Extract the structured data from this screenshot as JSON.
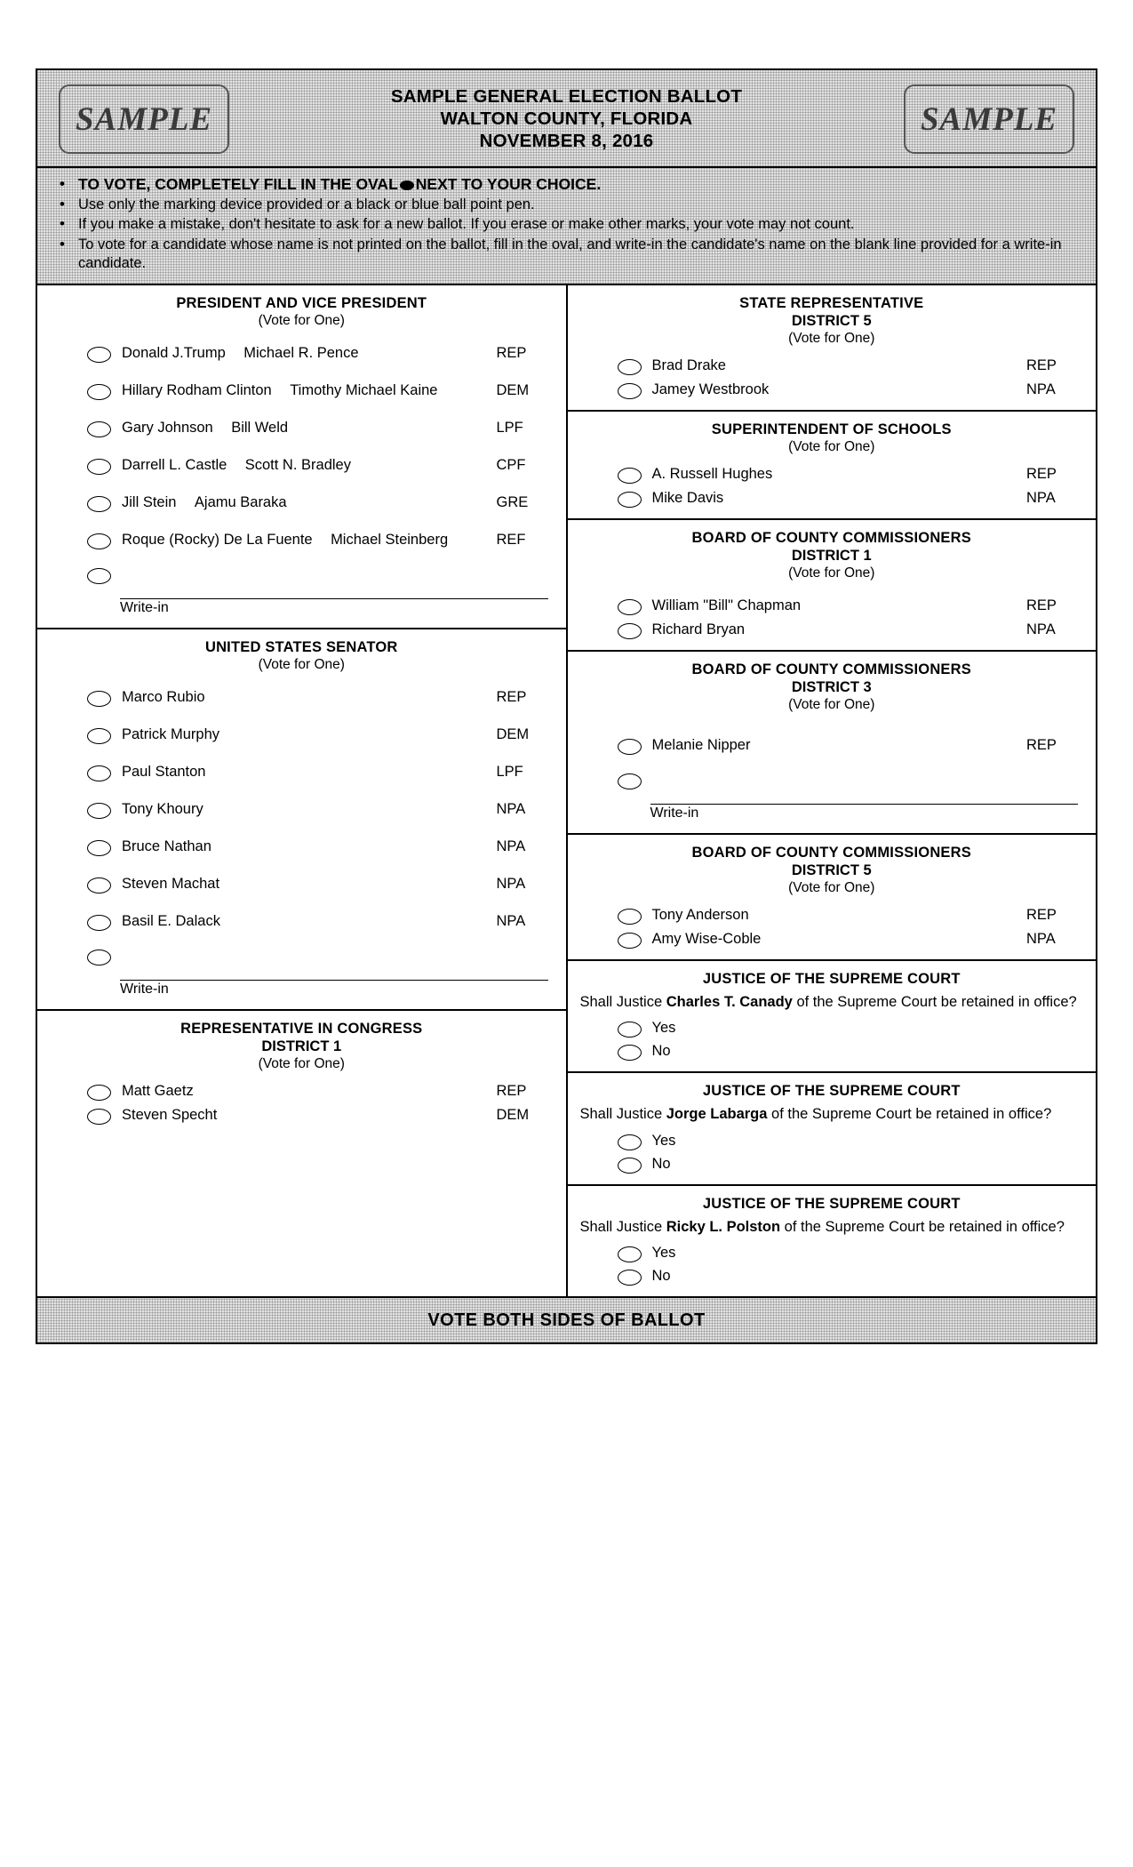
{
  "header": {
    "stamp_left": "SAMPLE",
    "stamp_right": "SAMPLE",
    "line1": "SAMPLE GENERAL ELECTION BALLOT",
    "line2": "WALTON COUNTY, FLORIDA",
    "line3": "NOVEMBER 8, 2016"
  },
  "instructions": {
    "item1_before": "TO VOTE, COMPLETELY FILL IN THE OVAL",
    "item1_after": "NEXT TO YOUR CHOICE.",
    "item2": "Use only the marking device provided or a black or blue ball point pen.",
    "item3": "If you make a mistake, don't hesitate to ask for a new ballot. If you erase or make other marks, your vote may not count.",
    "item4": "To vote for a candidate whose name is not printed on the ballot, fill in the oval, and write-in the candidate's name on the blank line provided for a write-in candidate."
  },
  "left_column": {
    "president": {
      "title": "PRESIDENT AND VICE PRESIDENT",
      "vote_for": "(Vote for One)",
      "candidates": [
        {
          "name": "Donald J.Trump",
          "running_mate": "Michael R. Pence",
          "party": "REP"
        },
        {
          "name": "Hillary Rodham Clinton",
          "running_mate": "Timothy Michael Kaine",
          "party": "DEM"
        },
        {
          "name": "Gary Johnson",
          "running_mate": "Bill Weld",
          "party": "LPF"
        },
        {
          "name": "Darrell L. Castle",
          "running_mate": "Scott N. Bradley",
          "party": "CPF"
        },
        {
          "name": "Jill Stein",
          "running_mate": "Ajamu Baraka",
          "party": "GRE"
        },
        {
          "name": "Roque (Rocky) De La Fuente",
          "running_mate": "Michael Steinberg",
          "party": "REF"
        }
      ],
      "writein_label": "Write-in"
    },
    "senator": {
      "title": "UNITED STATES SENATOR",
      "vote_for": "(Vote for One)",
      "candidates": [
        {
          "name": "Marco Rubio",
          "party": "REP"
        },
        {
          "name": "Patrick Murphy",
          "party": "DEM"
        },
        {
          "name": "Paul Stanton",
          "party": "LPF"
        },
        {
          "name": "Tony Khoury",
          "party": "NPA"
        },
        {
          "name": "Bruce Nathan",
          "party": "NPA"
        },
        {
          "name": "Steven Machat",
          "party": "NPA"
        },
        {
          "name": "Basil E. Dalack",
          "party": "NPA"
        }
      ],
      "writein_label": "Write-in"
    },
    "congress": {
      "title": "REPRESENTATIVE IN CONGRESS",
      "district": "DISTRICT 1",
      "vote_for": "(Vote for One)",
      "candidates": [
        {
          "name": "Matt Gaetz",
          "party": "REP"
        },
        {
          "name": "Steven Specht",
          "party": "DEM"
        }
      ]
    }
  },
  "right_column": {
    "state_rep": {
      "title": "STATE REPRESENTATIVE",
      "district": "DISTRICT 5",
      "vote_for": "(Vote for One)",
      "candidates": [
        {
          "name": "Brad Drake",
          "party": "REP"
        },
        {
          "name": "Jamey Westbrook",
          "party": "NPA"
        }
      ]
    },
    "superintendent": {
      "title": "SUPERINTENDENT OF SCHOOLS",
      "vote_for": "(Vote for One)",
      "candidates": [
        {
          "name": "A. Russell Hughes",
          "party": "REP"
        },
        {
          "name": "Mike Davis",
          "party": "NPA"
        }
      ]
    },
    "commissioner_d1": {
      "title": "BOARD OF COUNTY COMMISSIONERS",
      "district": "DISTRICT 1",
      "vote_for": "(Vote for One)",
      "candidates": [
        {
          "name": "William \"Bill\" Chapman",
          "party": "REP"
        },
        {
          "name": "Richard Bryan",
          "party": "NPA"
        }
      ]
    },
    "commissioner_d3": {
      "title": "BOARD OF COUNTY COMMISSIONERS",
      "district": "DISTRICT 3",
      "vote_for": "(Vote for One)",
      "candidates": [
        {
          "name": "Melanie Nipper",
          "party": "REP"
        }
      ],
      "writein_label": "Write-in"
    },
    "commissioner_d5": {
      "title": "BOARD OF COUNTY COMMISSIONERS",
      "district": "DISTRICT 5",
      "vote_for": "(Vote for One)",
      "candidates": [
        {
          "name": "Tony Anderson",
          "party": "REP"
        },
        {
          "name": "Amy Wise-Coble",
          "party": "NPA"
        }
      ]
    },
    "justice1": {
      "title": "JUSTICE OF THE SUPREME COURT",
      "prefix": "Shall Justice ",
      "justice_name": "Charles T. Canady",
      "suffix": " of the Supreme Court be retained in office?",
      "yes": "Yes",
      "no": "No"
    },
    "justice2": {
      "title": "JUSTICE OF THE SUPREME COURT",
      "prefix": "Shall Justice ",
      "justice_name": "Jorge Labarga",
      "suffix": " of the Supreme Court be retained in office?",
      "yes": "Yes",
      "no": "No"
    },
    "justice3": {
      "title": "JUSTICE OF THE SUPREME COURT",
      "prefix": "Shall Justice ",
      "justice_name": "Ricky L. Polston",
      "suffix": " of the Supreme Court be retained in office?",
      "yes": "Yes",
      "no": "No"
    }
  },
  "footer": {
    "text": "VOTE BOTH SIDES OF BALLOT"
  }
}
